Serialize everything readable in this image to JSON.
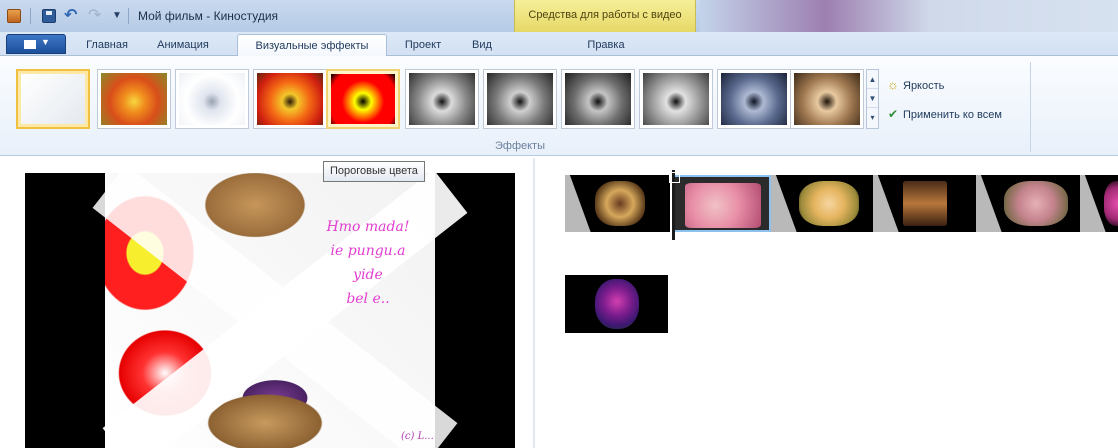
{
  "window": {
    "title": "Мой фильм - Киностудия",
    "context_header": "Средства для работы с видео"
  },
  "tabs": [
    {
      "label": "Главная"
    },
    {
      "label": "Анимация"
    },
    {
      "label": "Визуальные эффекты",
      "active": true
    },
    {
      "label": "Проект"
    },
    {
      "label": "Вид"
    },
    {
      "label": "Правка"
    }
  ],
  "ribbon": {
    "group_label": "Эффекты",
    "commands": {
      "brightness": "Яркость",
      "apply_all": "Применить ко всем"
    },
    "effects": [
      {
        "name": "none",
        "selected": true
      },
      {
        "name": "blur"
      },
      {
        "name": "edge-detect"
      },
      {
        "name": "cyan-warm"
      },
      {
        "name": "threshold",
        "highlighted": true
      },
      {
        "name": "grayscale"
      },
      {
        "name": "grayscale-2"
      },
      {
        "name": "grayscale-3"
      },
      {
        "name": "grayscale-4"
      },
      {
        "name": "blue-tint"
      },
      {
        "name": "sepia"
      }
    ]
  },
  "tooltip": "Пороговые цвета",
  "preview": {
    "overlay_lines": [
      "Hmo mada!",
      "ie pungu.a",
      "yide",
      "bel e.."
    ],
    "signature": "(c) L..."
  },
  "colors": {
    "ribbon_bg": "#e8f0fa",
    "context_yellow": "#e6d866",
    "selection_blue": "#8cc1f0"
  }
}
